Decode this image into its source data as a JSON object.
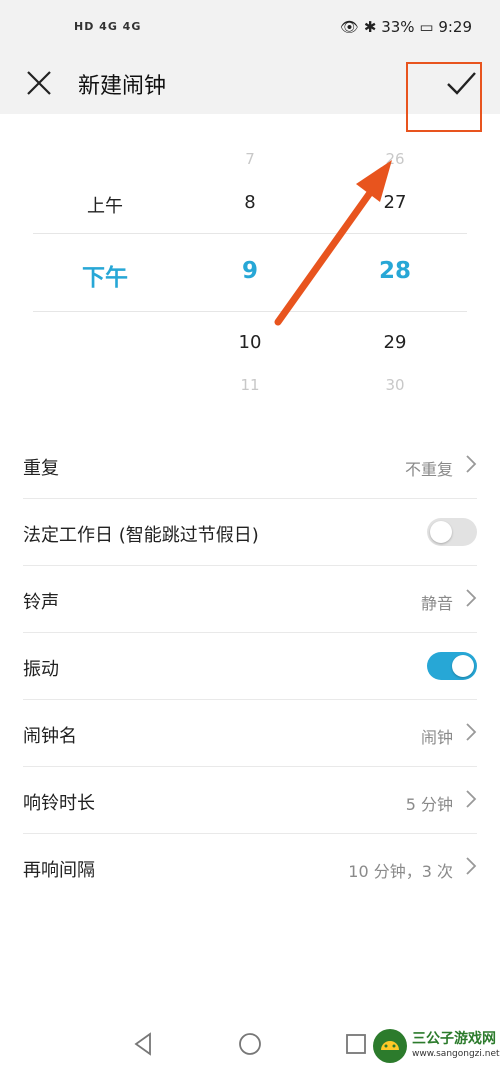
{
  "status_bar": {
    "left_icons": "HD 4G 4G",
    "battery": "33%",
    "time": "9:29"
  },
  "header": {
    "title": "新建闹钟"
  },
  "picker": {
    "ampm": {
      "above": "上午",
      "selected": "下午"
    },
    "hours": {
      "above2": "7",
      "above1": "8",
      "selected": "9",
      "below1": "10",
      "below2": "11"
    },
    "minutes": {
      "above2": "26",
      "above1": "27",
      "selected": "28",
      "below1": "29",
      "below2": "30"
    }
  },
  "settings": {
    "repeat": {
      "label": "重复",
      "value": "不重复"
    },
    "workday": {
      "label": "法定工作日 (智能跳过节假日)",
      "enabled": false
    },
    "ringtone": {
      "label": "铃声",
      "value": "静音"
    },
    "vibrate": {
      "label": "振动",
      "enabled": true
    },
    "alarm_name": {
      "label": "闹钟名",
      "value": "闹钟"
    },
    "ring_duration": {
      "label": "响铃时长",
      "value": "5 分钟"
    },
    "snooze": {
      "label": "再响间隔",
      "value": "10 分钟，3 次"
    }
  },
  "watermark": {
    "title": "三公子游戏网",
    "subtitle": "www.sangongzi.net"
  },
  "colors": {
    "accent": "#27a7d6",
    "annotation": "#e8541e",
    "toggle_off": "#e2e2e2"
  }
}
